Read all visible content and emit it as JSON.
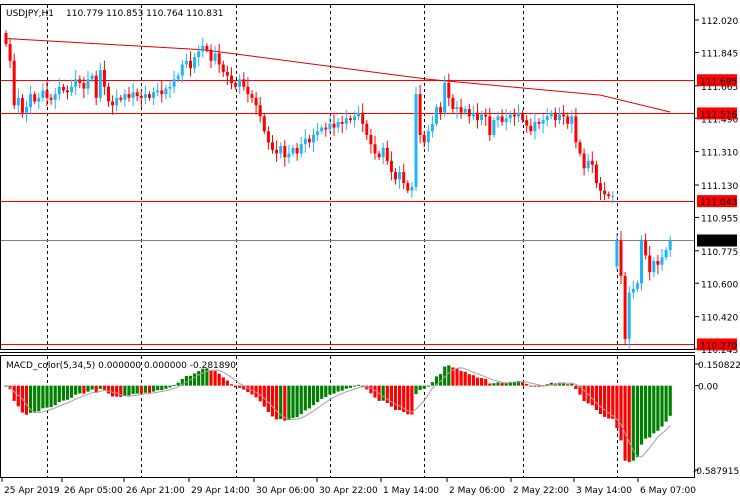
{
  "header": {
    "symbol": "USDJPY,H1",
    "ohlc": "110.779 110.853 110.764 110.831"
  },
  "macd_header": "MACD_color(5,34,5) 0.000000 0.000000 -0.281890",
  "colors": {
    "bull": "#1fb5f5",
    "bear": "#ff0000",
    "level": "#ff0000",
    "current": "#808080",
    "macd_up": "#008000",
    "macd_down": "#ff0000",
    "signal": "#a0a0a0"
  },
  "chart_data": {
    "type": "candlestick",
    "title": "USDJPY,H1",
    "ylim": [
      110.245,
      112.1
    ],
    "price_ticks": [
      "112.020",
      "111.845",
      "111.665",
      "111.490",
      "111.310",
      "111.130",
      "110.955",
      "110.775",
      "110.600",
      "110.420",
      "110.245"
    ],
    "x_tick_labels": [
      "25 Apr 2019",
      "26 Apr 05:00",
      "26 Apr 21:00",
      "29 Apr 14:00",
      "30 Apr 06:00",
      "30 Apr 22:00",
      "1 May 14:00",
      "2 May 06:00",
      "2 May 22:00",
      "3 May 14:00",
      "6 May 07:00"
    ],
    "x_tick_indices": [
      0,
      11,
      33,
      56,
      79,
      102,
      125,
      148,
      134,
      149,
      160
    ],
    "grid_indices": [
      10,
      33,
      56,
      79,
      102,
      126,
      149
    ],
    "first_open": 111.95,
    "session_open": {
      "index": 149,
      "open": 110.69
    },
    "closes": [
      111.89,
      111.8,
      111.56,
      111.6,
      111.52,
      111.55,
      111.62,
      111.58,
      111.6,
      111.64,
      111.6,
      111.59,
      111.62,
      111.66,
      111.64,
      111.63,
      111.66,
      111.7,
      111.68,
      111.65,
      111.7,
      111.72,
      111.6,
      111.75,
      111.66,
      111.58,
      111.56,
      111.6,
      111.59,
      111.62,
      111.6,
      111.63,
      111.61,
      111.6,
      111.62,
      111.6,
      111.63,
      111.64,
      111.62,
      111.65,
      111.66,
      111.7,
      111.72,
      111.78,
      111.8,
      111.76,
      111.82,
      111.85,
      111.88,
      111.86,
      111.8,
      111.84,
      111.78,
      111.74,
      111.72,
      111.68,
      111.66,
      111.7,
      111.66,
      111.62,
      111.6,
      111.56,
      111.5,
      111.42,
      111.36,
      111.32,
      111.3,
      111.34,
      111.28,
      111.3,
      111.33,
      111.3,
      111.35,
      111.38,
      111.36,
      111.4,
      111.42,
      111.44,
      111.43,
      111.46,
      111.44,
      111.47,
      111.46,
      111.49,
      111.48,
      111.5,
      111.52,
      111.46,
      111.4,
      111.35,
      111.3,
      111.28,
      111.33,
      111.26,
      111.2,
      111.16,
      111.2,
      111.14,
      111.1,
      111.12,
      111.62,
      111.4,
      111.36,
      111.42,
      111.46,
      111.55,
      111.52,
      111.68,
      111.6,
      111.54,
      111.55,
      111.52,
      111.54,
      111.5,
      111.52,
      111.48,
      111.51,
      111.5,
      111.4,
      111.48,
      111.5,
      111.47,
      111.49,
      111.51,
      111.5,
      111.52,
      111.48,
      111.45,
      111.42,
      111.47,
      111.46,
      111.48,
      111.5,
      111.52,
      111.48,
      111.51,
      111.5,
      111.46,
      111.5,
      111.36,
      111.3,
      111.22,
      111.26,
      111.24,
      111.14,
      111.1,
      111.08,
      111.07,
      111.07,
      110.83,
      110.64,
      110.3,
      110.55,
      110.57,
      110.6,
      110.83,
      110.75,
      110.66,
      110.72,
      110.7,
      110.74,
      110.78,
      110.83
    ],
    "moving_average": [
      [
        0,
        111.92
      ],
      [
        48,
        111.86
      ],
      [
        103,
        111.7
      ],
      [
        145,
        111.615
      ],
      [
        162,
        111.524
      ]
    ],
    "levels": [
      {
        "price": 111.695,
        "label": "111.695"
      },
      {
        "price": 111.516,
        "label": "111.516"
      },
      {
        "price": 111.043,
        "label": "111.043"
      },
      {
        "price": 110.27,
        "label": "110.270"
      }
    ],
    "current_price": {
      "price": 110.831,
      "label": "110.831"
    },
    "macd": {
      "fast": 5,
      "slow": 34,
      "signal": 5,
      "ylim": [
        -0.587915,
        0.150822
      ],
      "tick_labels": [
        "0.150822",
        "0.00",
        "-0.587915"
      ]
    }
  }
}
